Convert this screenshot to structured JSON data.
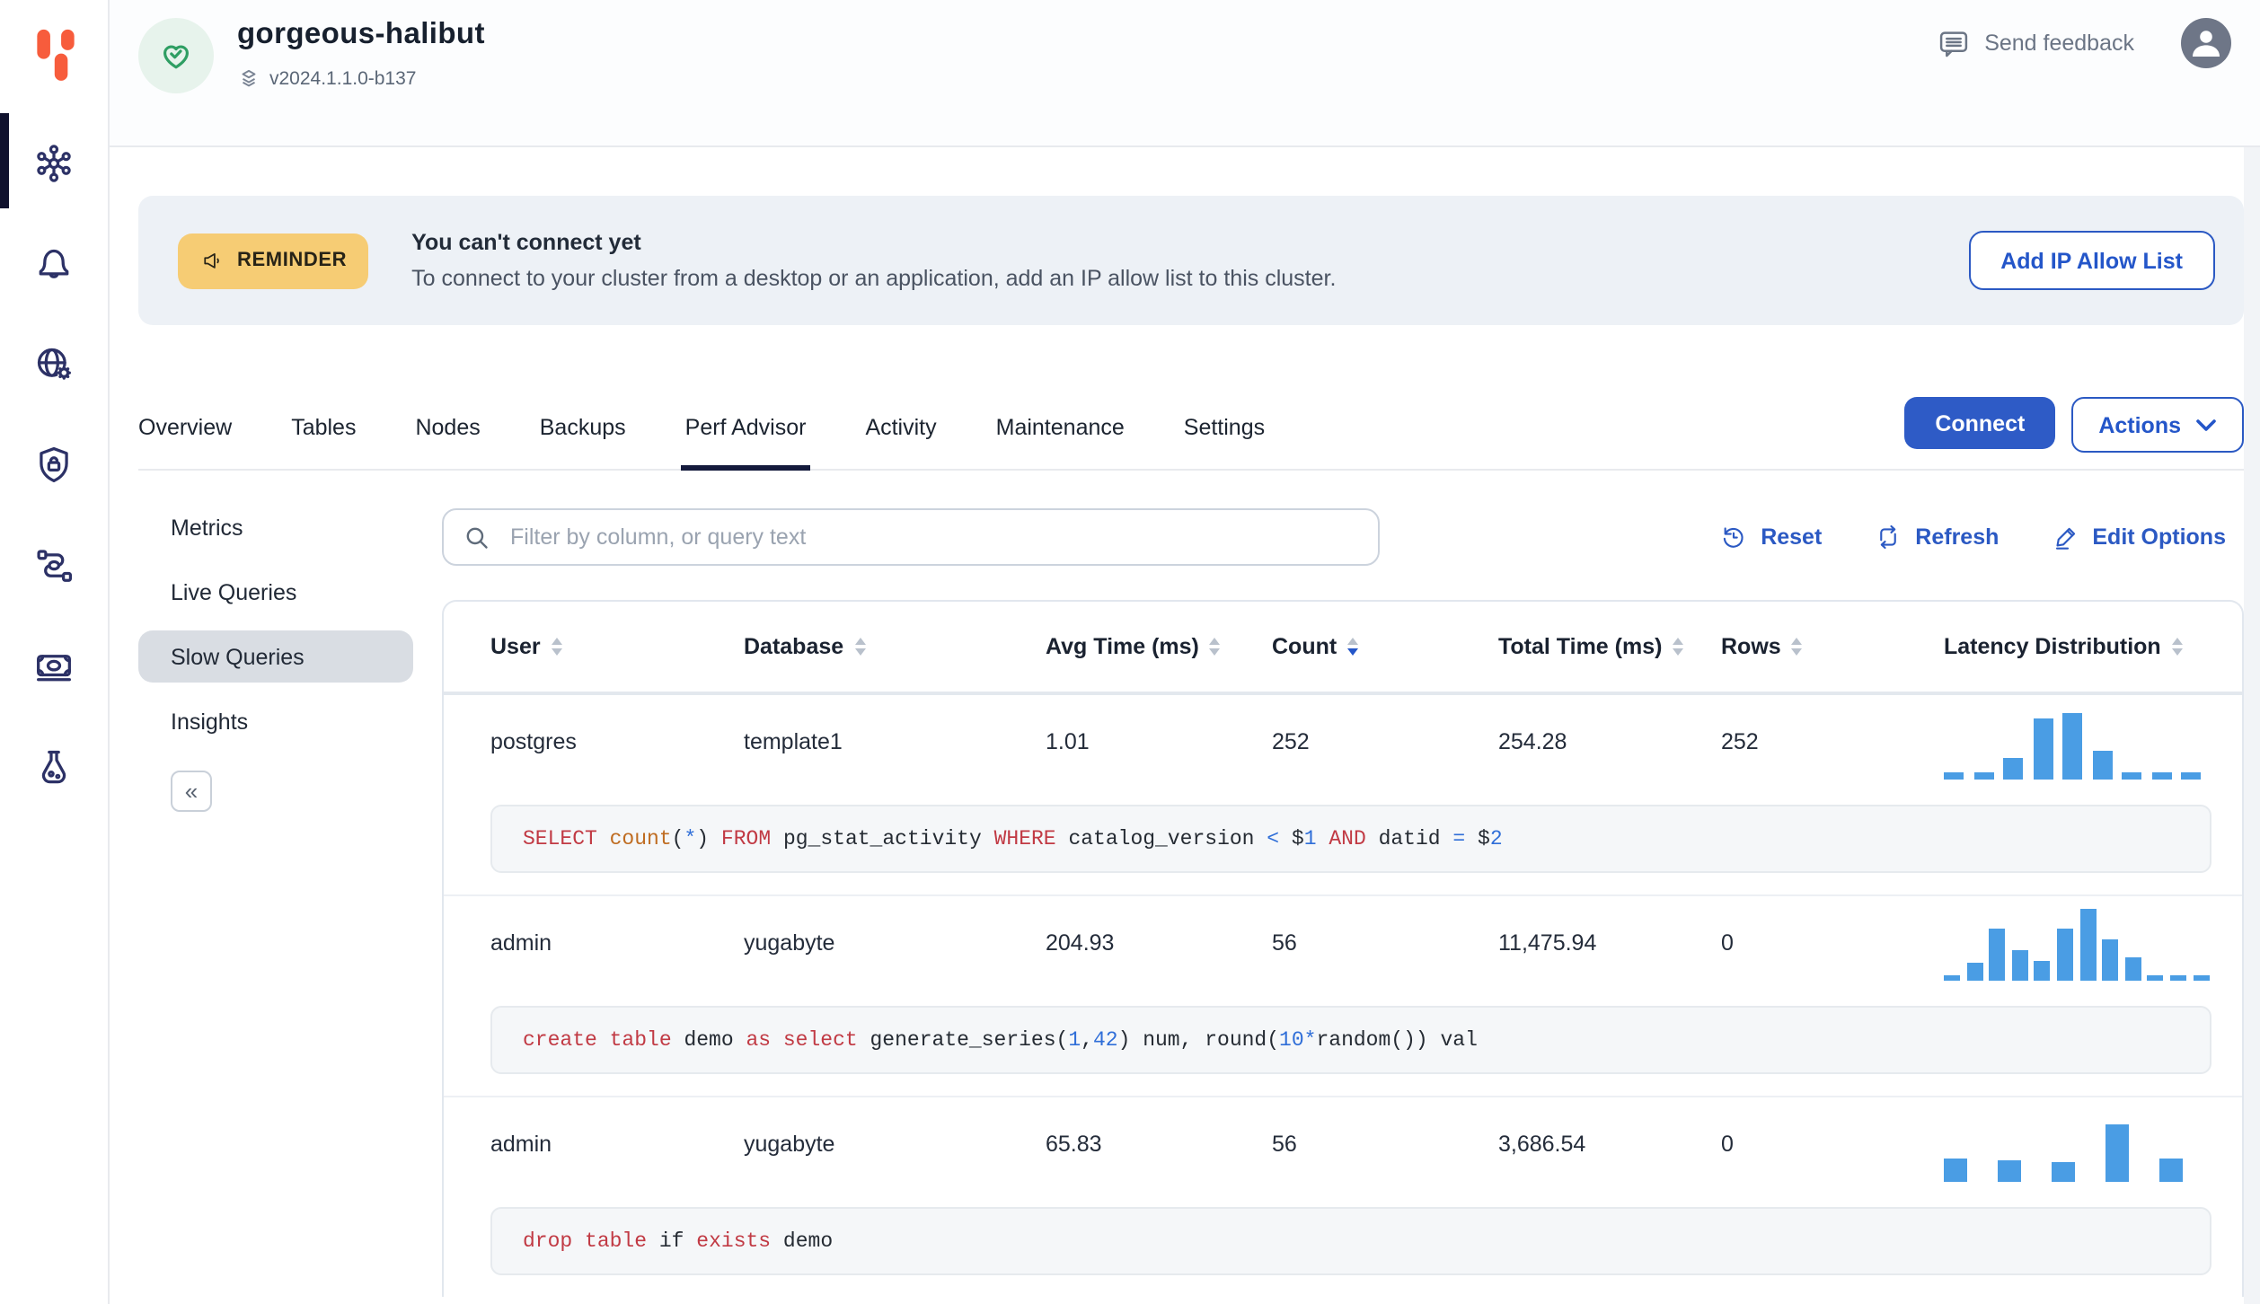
{
  "header": {
    "cluster_name": "gorgeous-halibut",
    "version": "v2024.1.1.0-b137",
    "send_feedback": "Send feedback"
  },
  "banner": {
    "badge": "REMINDER",
    "title": "You can't connect yet",
    "message": "To connect to your cluster from a desktop or an application, add an IP allow list to this cluster.",
    "action": "Add IP Allow List"
  },
  "tabs": {
    "items": [
      "Overview",
      "Tables",
      "Nodes",
      "Backups",
      "Perf Advisor",
      "Activity",
      "Maintenance",
      "Settings"
    ],
    "active": "Perf Advisor",
    "connect": "Connect",
    "actions": "Actions"
  },
  "subnav": {
    "items": [
      "Metrics",
      "Live Queries",
      "Slow Queries",
      "Insights"
    ],
    "active": "Slow Queries",
    "collapse": "«"
  },
  "toolbar": {
    "filter_placeholder": "Filter by column, or query text",
    "reset": "Reset",
    "refresh": "Refresh",
    "edit_options": "Edit Options"
  },
  "table": {
    "columns": [
      "User",
      "Database",
      "Avg Time (ms)",
      "Count",
      "Total Time (ms)",
      "Rows",
      "Latency Distribution"
    ],
    "sorted_by": "Count",
    "sort_direction": "desc",
    "rows": [
      {
        "user": "postgres",
        "database": "template1",
        "avg_time": "1.01",
        "count": "252",
        "total_time": "254.28",
        "rows": "252",
        "latency_hist": [
          0.11,
          0.11,
          0.33,
          0.91,
          1.0,
          0.43,
          0.11,
          0.11,
          0.11
        ],
        "hist_bar_w": 11,
        "hist_gap": 5.5,
        "hist_max_h": 37,
        "query": [
          {
            "text": "SELECT ",
            "type": "kw"
          },
          {
            "text": "count",
            "type": "fn"
          },
          {
            "text": "(",
            "type": "pl"
          },
          {
            "text": "*",
            "type": "num"
          },
          {
            "text": ") ",
            "type": "pl"
          },
          {
            "text": "FROM ",
            "type": "kw"
          },
          {
            "text": "pg_stat_activity ",
            "type": "pl"
          },
          {
            "text": "WHERE ",
            "type": "kw"
          },
          {
            "text": "catalog_version ",
            "type": "pl"
          },
          {
            "text": "<",
            "type": "num"
          },
          {
            "text": " $",
            "type": "pl"
          },
          {
            "text": "1 ",
            "type": "num"
          },
          {
            "text": "AND ",
            "type": "kw"
          },
          {
            "text": "datid ",
            "type": "pl"
          },
          {
            "text": "=",
            "type": "num"
          },
          {
            "text": " $",
            "type": "pl"
          },
          {
            "text": "2",
            "type": "num"
          }
        ]
      },
      {
        "user": "admin",
        "database": "yugabyte",
        "avg_time": "204.93",
        "count": "56",
        "total_time": "11,475.94",
        "rows": "0",
        "latency_hist": [
          0.08,
          0.25,
          0.72,
          0.42,
          0.27,
          0.73,
          1.0,
          0.57,
          0.33,
          0.08,
          0.08,
          0.08
        ],
        "hist_bar_w": 9,
        "hist_gap": 3.6,
        "hist_max_h": 40,
        "query": [
          {
            "text": "create table ",
            "type": "kw"
          },
          {
            "text": "demo ",
            "type": "pl"
          },
          {
            "text": "as select ",
            "type": "kw"
          },
          {
            "text": "generate_series(",
            "type": "pl"
          },
          {
            "text": "1",
            "type": "num"
          },
          {
            "text": ",",
            "type": "pl"
          },
          {
            "text": "42",
            "type": "num"
          },
          {
            "text": ") num, round(",
            "type": "pl"
          },
          {
            "text": "10",
            "type": "num"
          },
          {
            "text": "*",
            "type": "num"
          },
          {
            "text": "random()) val",
            "type": "pl"
          }
        ]
      },
      {
        "user": "admin",
        "database": "yugabyte",
        "avg_time": "65.83",
        "count": "56",
        "total_time": "3,686.54",
        "rows": "0",
        "latency_hist": [
          0.42,
          0.37,
          0.35,
          1.0,
          0.42
        ],
        "hist_bar_w": 12.5,
        "hist_gap": 17.5,
        "hist_max_h": 32,
        "query": [
          {
            "text": "drop table ",
            "type": "kw"
          },
          {
            "text": "if ",
            "type": "pl"
          },
          {
            "text": "exists ",
            "type": "kw"
          },
          {
            "text": "demo",
            "type": "pl"
          }
        ]
      }
    ]
  },
  "colors": {
    "accent": "#2b59c3",
    "histogram": "#4a9de4",
    "badge_bg": "#f6cc74",
    "status_green": "#2f9e63",
    "active_tab_underline": "#141a3c",
    "sql_keyword": "#c13a44",
    "sql_function": "#bf6c21",
    "sql_number": "#2f6ed8"
  }
}
